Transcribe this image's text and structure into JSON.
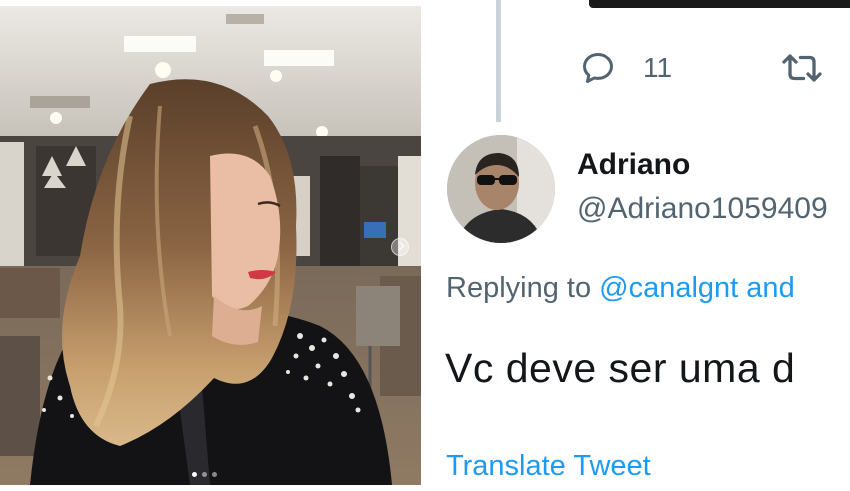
{
  "tweet": {
    "reply_count": "11",
    "author": {
      "display_name": "Adriano",
      "handle": "@Adriano1059409"
    },
    "replying_prefix": "Replying to ",
    "replying_mention": "@canalgnt",
    "replying_suffix": " and",
    "text": "Vc deve ser uma d",
    "translate_label": "Translate Tweet"
  },
  "colors": {
    "link": "#1d9bf0",
    "secondary_text": "#536471",
    "primary_text": "#14171a",
    "thread_line": "#c9d1d9"
  },
  "icons": {
    "reply": "reply-icon",
    "retweet": "retweet-icon",
    "carousel_next": "chevron-right-icon"
  }
}
